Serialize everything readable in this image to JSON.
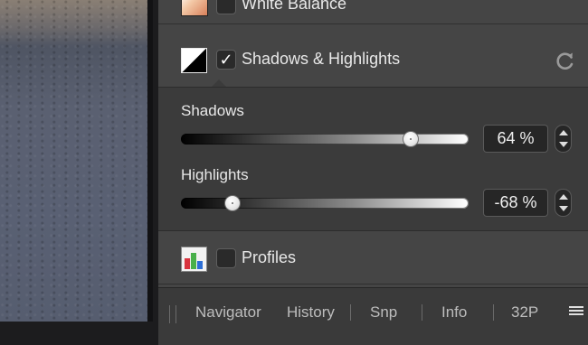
{
  "white_balance": {
    "label": "White Balance"
  },
  "shadows_highlights": {
    "label": "Shadows & Highlights",
    "checked": true,
    "check_glyph": "✓",
    "reset_icon": "reset-icon"
  },
  "sliders": [
    {
      "label": "Shadows",
      "value_text": "64 %",
      "value": 64,
      "min": -100,
      "max": 100,
      "position_fraction": 0.8
    },
    {
      "label": "Highlights",
      "value_text": "-68 %",
      "value": -68,
      "min": -100,
      "max": 100,
      "position_fraction": 0.18
    }
  ],
  "profiles": {
    "label": "Profiles",
    "icon_colors": [
      "#d8343f",
      "#48b04a",
      "#2c6ed6"
    ]
  },
  "bottom_tabs": [
    {
      "label": "Navigator"
    },
    {
      "label": "History"
    },
    {
      "label": "Snp"
    },
    {
      "label": "Info"
    },
    {
      "label": "32P"
    }
  ],
  "menu_icon": "hamburger-menu-icon"
}
